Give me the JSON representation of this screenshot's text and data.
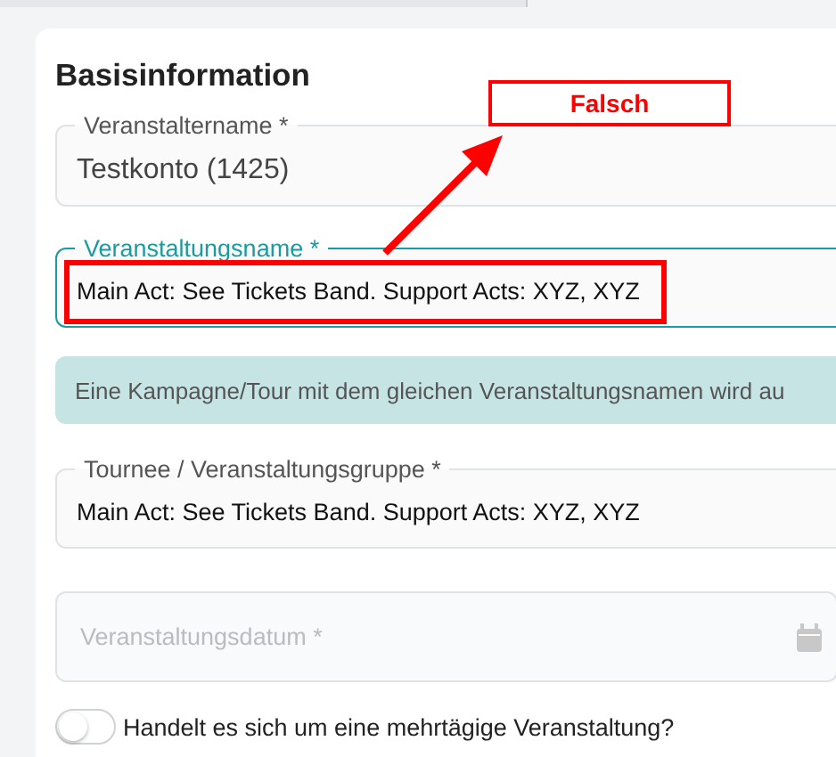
{
  "section_title": "Basisinformation",
  "fields": [
    {
      "kind": "text",
      "label": "Veranstaltername *",
      "value": "Testkonto (1425)",
      "focused": false,
      "large": true
    },
    {
      "kind": "text",
      "label": "Veranstaltungsname *",
      "value": "Main Act: See Tickets Band. Support Acts: XYZ, XYZ",
      "focused": true,
      "large": false
    },
    {
      "kind": "info",
      "text": "Eine Kampagne/Tour mit dem gleichen Veranstaltungsnamen wird au"
    },
    {
      "kind": "text",
      "label": "Tournee / Veranstaltungsgruppe *",
      "value": "Main Act: See Tickets Band. Support Acts: XYZ, XYZ",
      "focused": false,
      "large": false
    },
    {
      "kind": "date",
      "placeholder": "Veranstaltungsdatum *"
    },
    {
      "kind": "toggle",
      "label": "Handelt es sich um eine mehrtägige Veranstaltung?",
      "on": false
    }
  ],
  "annotation": {
    "label": "Falsch"
  }
}
